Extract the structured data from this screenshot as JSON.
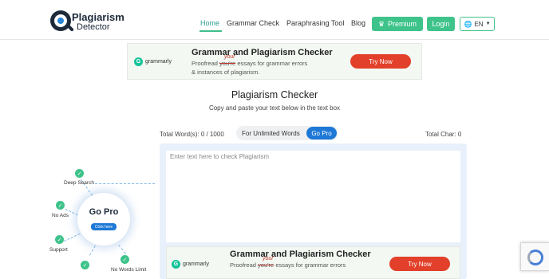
{
  "header": {
    "logo_line1": "Plagiarism",
    "logo_line2": "Detector",
    "nav": {
      "home": "Home",
      "grammar": "Grammar Check",
      "paraphrasing": "Paraphrasing Tool",
      "blog": "Blog"
    },
    "premium_label": "Premium",
    "login_label": "Login",
    "language": "EN"
  },
  "ads": {
    "brand": "grammarly",
    "title": "Grammar and Plagiarism Checker",
    "sub_before": "Proofread ",
    "sub_struck": "you're",
    "sub_correction": "your",
    "sub_after": " essays for grammar errors",
    "sub_line2": "& instances of plagiarism.",
    "cta": "Try Now"
  },
  "main": {
    "title": "Plagiarism Checker",
    "subtitle": "Copy and paste your text below in the text box",
    "word_count": "Total Word(s): 0 / 1000",
    "unlimited_label": "For Unlimited Words",
    "go_pro_label": "Go Pro",
    "char_count": "Total Char: 0",
    "editor_placeholder": "Enter text here to check Plagiarism"
  },
  "promo": {
    "title": "Go Pro",
    "button": "Click here",
    "features": [
      "Deep Search",
      "No Ads",
      "Support",
      "No Words Limit"
    ]
  },
  "colors": {
    "accent_green": "#3ec38a",
    "accent_blue": "#1e78d6",
    "ad_red": "#e2402a"
  },
  "icons": {
    "premium": "crown-icon",
    "language": "globe-icon",
    "check": "check-icon"
  }
}
